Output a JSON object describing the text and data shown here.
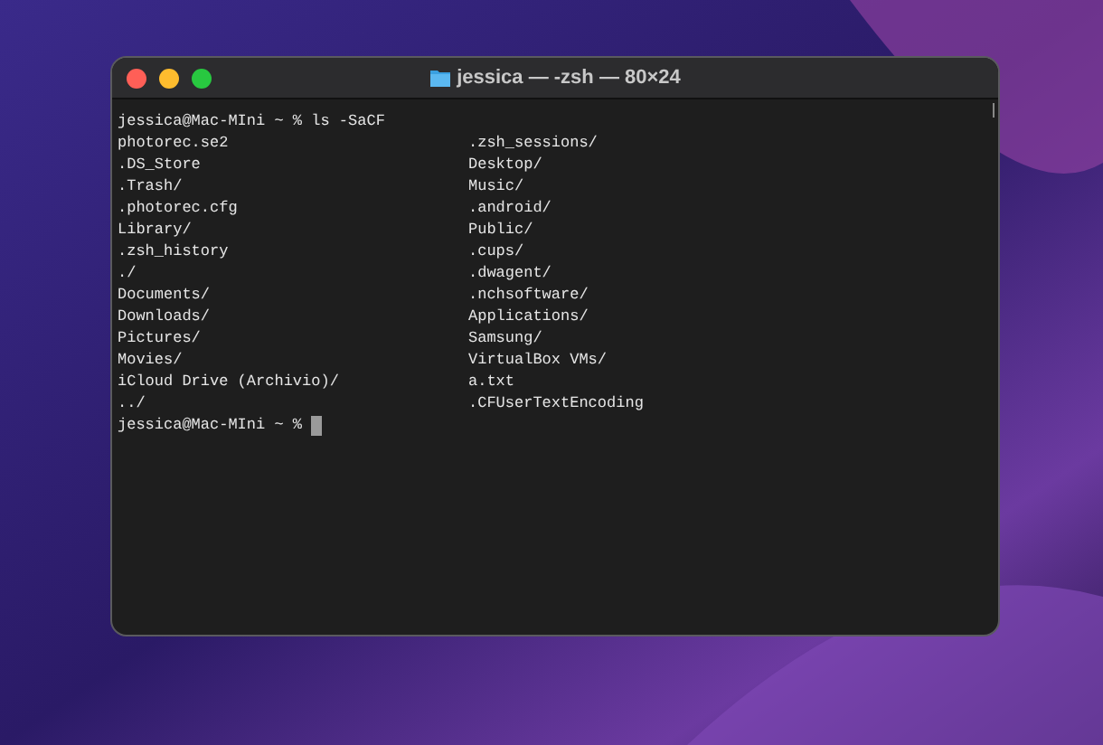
{
  "window": {
    "title": "jessica — -zsh — 80×24"
  },
  "terminal": {
    "command_line": "jessica@Mac-MIni ~ % ls -SaCF",
    "listing": [
      {
        "column_1": "photorec.se2",
        "column_2": ".zsh_sessions/"
      },
      {
        "column_1": ".DS_Store",
        "column_2": "Desktop/"
      },
      {
        "column_1": ".Trash/",
        "column_2": "Music/"
      },
      {
        "column_1": ".photorec.cfg",
        "column_2": ".android/"
      },
      {
        "column_1": "Library/",
        "column_2": "Public/"
      },
      {
        "column_1": ".zsh_history",
        "column_2": ".cups/"
      },
      {
        "column_1": "./",
        "column_2": ".dwagent/"
      },
      {
        "column_1": "Documents/",
        "column_2": ".nchsoftware/"
      },
      {
        "column_1": "Downloads/",
        "column_2": "Applications/"
      },
      {
        "column_1": "Pictures/",
        "column_2": "Samsung/"
      },
      {
        "column_1": "Movies/",
        "column_2": "VirtualBox VMs/"
      },
      {
        "column_1": "iCloud Drive (Archivio)/",
        "column_2": "a.txt"
      },
      {
        "column_1": "../",
        "column_2": ".CFUserTextEncoding"
      }
    ],
    "prompt": "jessica@Mac-MIni ~ %"
  }
}
